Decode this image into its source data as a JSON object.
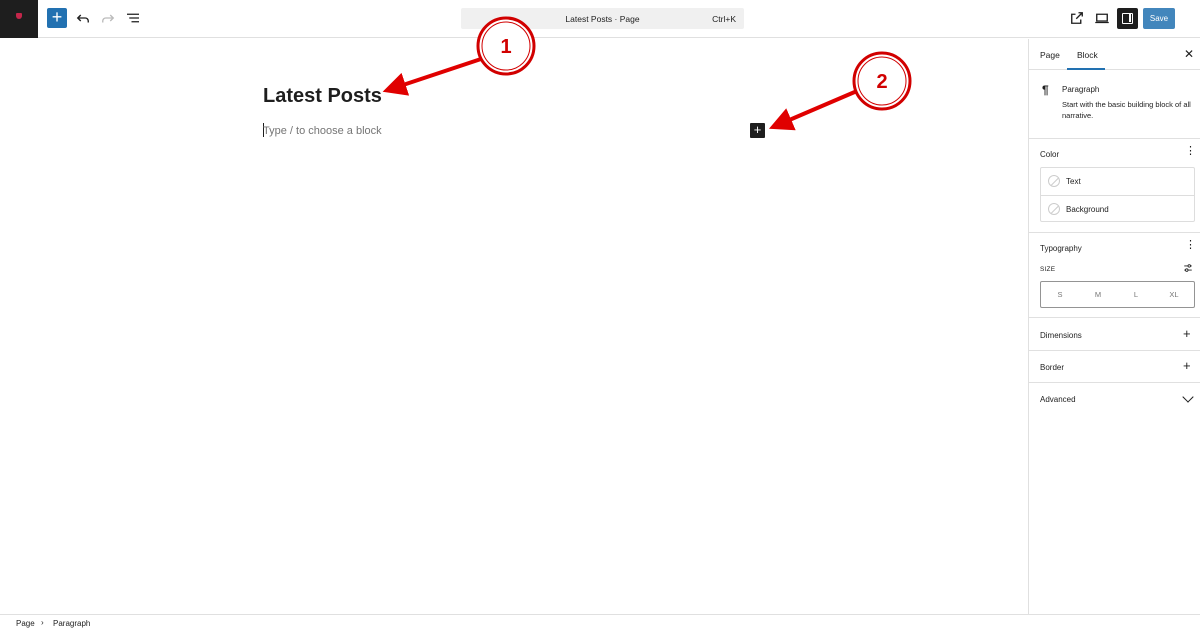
{
  "toolbar": {
    "add_block_label": "+",
    "command_title": "Latest Posts · Page",
    "command_shortcut": "Ctrl+K",
    "save_label": "Save"
  },
  "canvas": {
    "post_title": "Latest Posts",
    "block_placeholder": "Type / to choose a block",
    "inline_add_label": "+"
  },
  "annotations": [
    {
      "number": "1"
    },
    {
      "number": "2"
    }
  ],
  "sidebar": {
    "tabs": [
      {
        "label": "Page"
      },
      {
        "label": "Block"
      }
    ],
    "close_icon": "close-icon",
    "block_card": {
      "icon": "¶",
      "name": "Paragraph",
      "description": "Start with the basic building block of all narrative."
    },
    "color": {
      "title": "Color",
      "items": [
        {
          "label": "Text"
        },
        {
          "label": "Background"
        }
      ]
    },
    "typography": {
      "title": "Typography",
      "size_label": "SIZE",
      "sizes": [
        "S",
        "M",
        "L",
        "XL"
      ]
    },
    "dimensions": {
      "title": "Dimensions"
    },
    "border": {
      "title": "Border"
    },
    "advanced": {
      "title": "Advanced"
    }
  },
  "footer": {
    "breadcrumbs": [
      "Page",
      "Paragraph"
    ]
  },
  "colors": {
    "accent": "#2271b1",
    "annotation_red": "#e00000",
    "dark": "#1e1e1e"
  }
}
